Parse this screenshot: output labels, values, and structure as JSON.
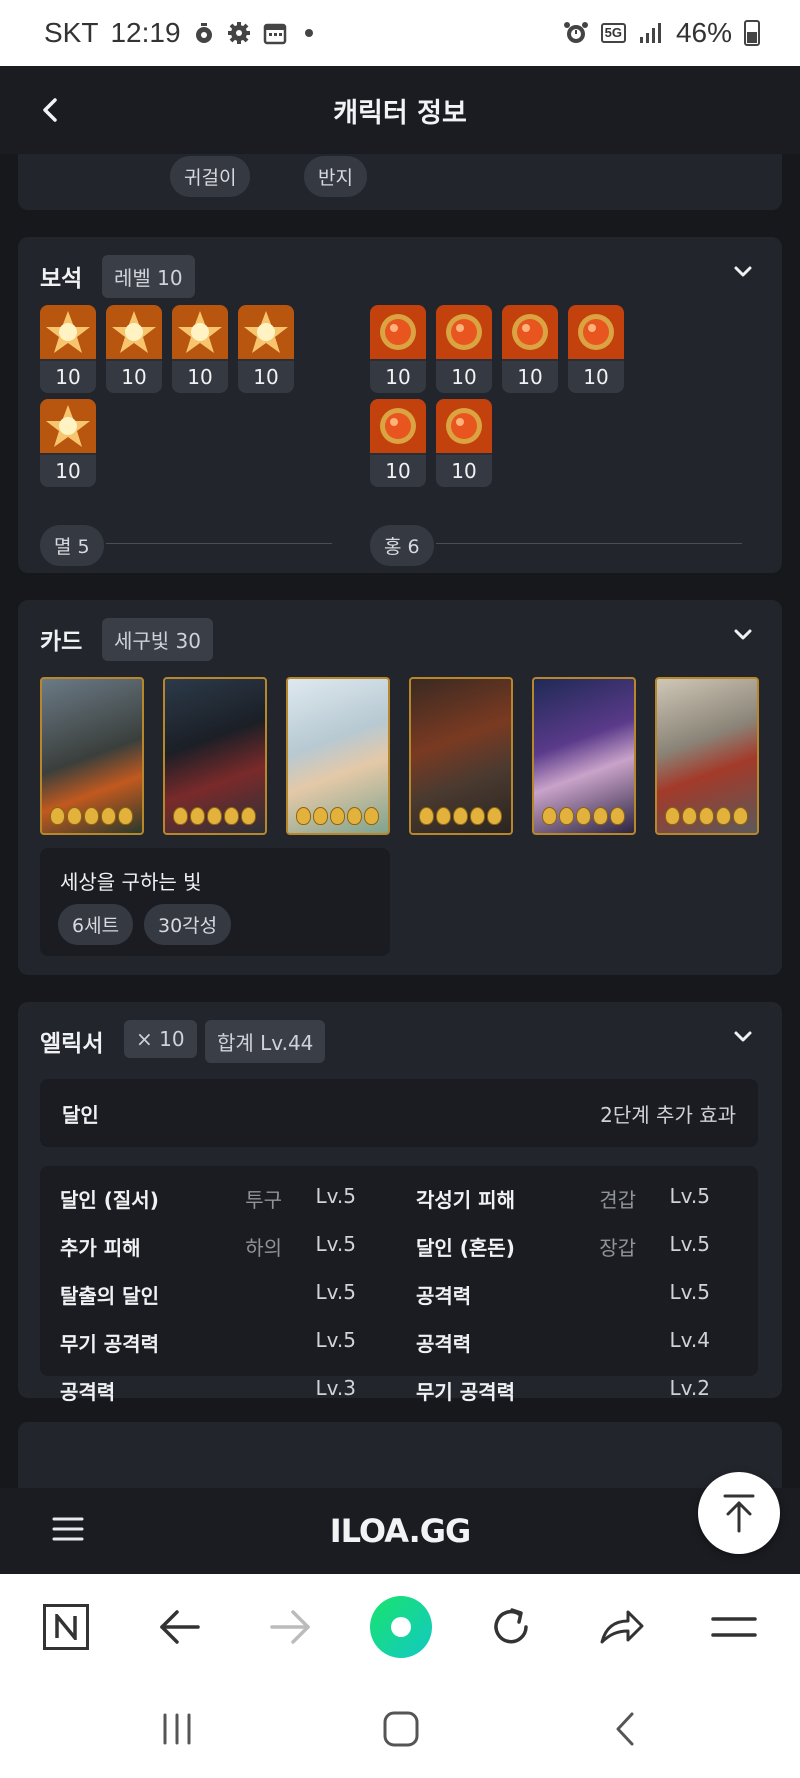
{
  "status_bar": {
    "carrier": "SKT",
    "time": "12:19",
    "network": "5G",
    "battery": "46%"
  },
  "header": {
    "title": "캐릭터 정보"
  },
  "accessory_chips": [
    "귀걸이",
    "반지"
  ],
  "gems": {
    "title": "보석",
    "tag": "레벨 10",
    "group_left": {
      "levels": [
        "10",
        "10",
        "10",
        "10",
        "10"
      ],
      "summary": "멸 5",
      "color": "#b8560f"
    },
    "group_right": {
      "levels": [
        "10",
        "10",
        "10",
        "10",
        "10",
        "10"
      ],
      "summary": "홍 6",
      "color": "#c2410c"
    }
  },
  "cards": {
    "title": "카드",
    "tag": "세구빛 30",
    "set_name": "세상을 구하는 빛",
    "set_chips": [
      "6세트",
      "30각성"
    ]
  },
  "elixir": {
    "title": "엘릭서",
    "count_tag": "× 10",
    "total_tag": "합계 Lv.44",
    "effect_name": "달인",
    "effect_stage": "2단계 추가 효과",
    "rows": [
      {
        "left": {
          "name": "달인 (질서)",
          "slot": "투구",
          "lv": "Lv.5"
        },
        "right": {
          "name": "각성기 피해",
          "slot": "견갑",
          "lv": "Lv.5"
        }
      },
      {
        "left": {
          "name": "추가 피해",
          "slot": "하의",
          "lv": "Lv.5"
        },
        "right": {
          "name": "달인 (혼돈)",
          "slot": "장갑",
          "lv": "Lv.5"
        }
      },
      {
        "left": {
          "name": "탈출의 달인",
          "slot": "",
          "lv": "Lv.5"
        },
        "right": {
          "name": "공격력",
          "slot": "",
          "lv": "Lv.5"
        }
      },
      {
        "left": {
          "name": "무기 공격력",
          "slot": "",
          "lv": "Lv.5"
        },
        "right": {
          "name": "공격력",
          "slot": "",
          "lv": "Lv.4"
        }
      },
      {
        "left": {
          "name": "공격력",
          "slot": "",
          "lv": "Lv.3"
        },
        "right": {
          "name": "무기 공격력",
          "slot": "",
          "lv": "Lv.2"
        }
      }
    ]
  },
  "app_nav": {
    "brand": "ILOA.GG"
  }
}
